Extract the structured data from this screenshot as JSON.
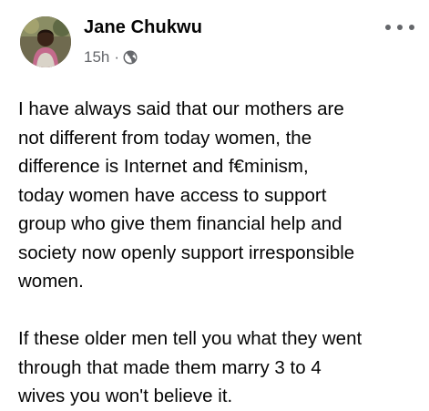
{
  "post": {
    "author": "Jane Chukwu",
    "timestamp": "15h",
    "separator": "·",
    "privacy_icon": "globe-icon",
    "more_icon": "more-options-icon",
    "paragraph1_lines": [
      "I have always said that our mothers are",
      "not different from today women, the",
      "difference is Internet and f€minism,",
      "today women have access to support",
      "group who give them financial help and",
      "society now openly support irresponsible",
      "women."
    ],
    "paragraph2_lines": [
      "If these older men tell you what they went",
      "through that made them marry 3 to 4",
      "wives you won't believe it."
    ]
  },
  "colors": {
    "text": "#050505",
    "secondary_text": "#65676b",
    "background": "#ffffff"
  }
}
